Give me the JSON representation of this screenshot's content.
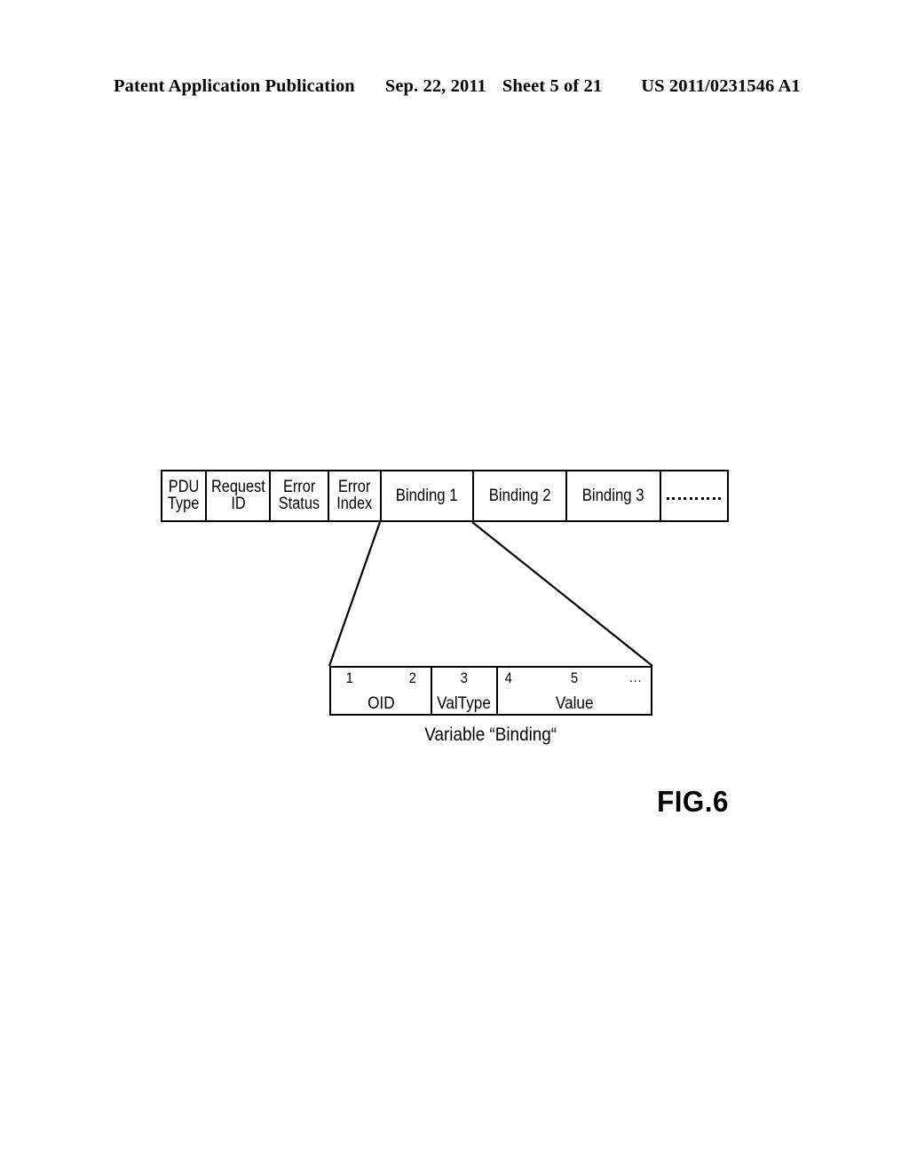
{
  "header": {
    "publication": "Patent Application Publication",
    "date": "Sep. 22, 2011",
    "sheet": "Sheet 5 of 21",
    "patent_number": "US 2011/0231546 A1"
  },
  "figure": {
    "label": "FIG.6",
    "pdu_message": {
      "cells": [
        {
          "line1": "PDU",
          "line2": "Type"
        },
        {
          "line1": "Request",
          "line2": "ID"
        },
        {
          "line1": "Error",
          "line2": "Status"
        },
        {
          "line1": "Error",
          "line2": "Index"
        },
        {
          "line1": "Binding 1",
          "line2": ""
        },
        {
          "line1": "Binding 2",
          "line2": ""
        },
        {
          "line1": "Binding 3",
          "line2": ""
        },
        {
          "line1": "",
          "line2": "",
          "ellipsis": true
        }
      ]
    },
    "variable_binding": {
      "caption": "Variable “Binding“",
      "cells": [
        {
          "label": "OID",
          "num_left": "1",
          "num_mid": "",
          "num_right": "2"
        },
        {
          "label": "ValType",
          "num_left": "",
          "num_mid": "3",
          "num_right": ""
        },
        {
          "label": "Value",
          "num_left": "4",
          "num_mid": "5",
          "num_right": "..."
        }
      ]
    }
  },
  "colors": {
    "ink": "#000000",
    "paper": "#ffffff"
  }
}
